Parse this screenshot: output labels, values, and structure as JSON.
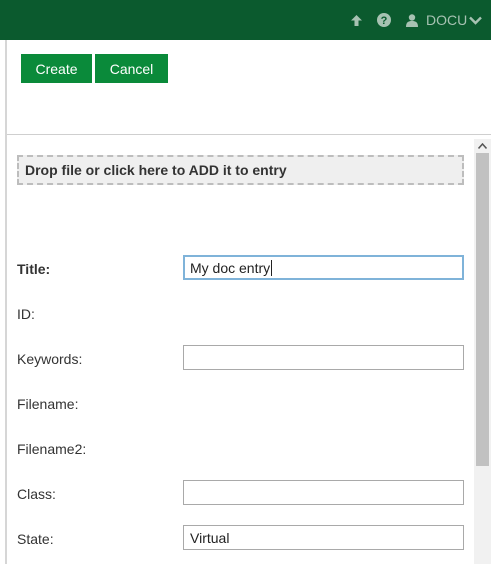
{
  "topbar": {
    "up_icon": "arrow-up-icon",
    "help_icon": "question-circle-icon",
    "user_icon": "user-icon",
    "user_label": "DOCU",
    "chevron_icon": "chevron-down-icon",
    "bg_color": "#0b5a2e"
  },
  "toolbar": {
    "create_label": "Create",
    "cancel_label": "Cancel",
    "button_color": "#0a8a3a"
  },
  "dropzone": {
    "text": "Drop file or click here to ADD it to entry"
  },
  "form": {
    "title_label": "Title:",
    "title_value": "My doc entry",
    "id_label": "ID:",
    "keywords_label": "Keywords:",
    "keywords_value": "",
    "filename_label": "Filename:",
    "filename2_label": "Filename2:",
    "class_label": "Class:",
    "class_value": "",
    "state_label": "State:",
    "state_value": "Virtual"
  }
}
